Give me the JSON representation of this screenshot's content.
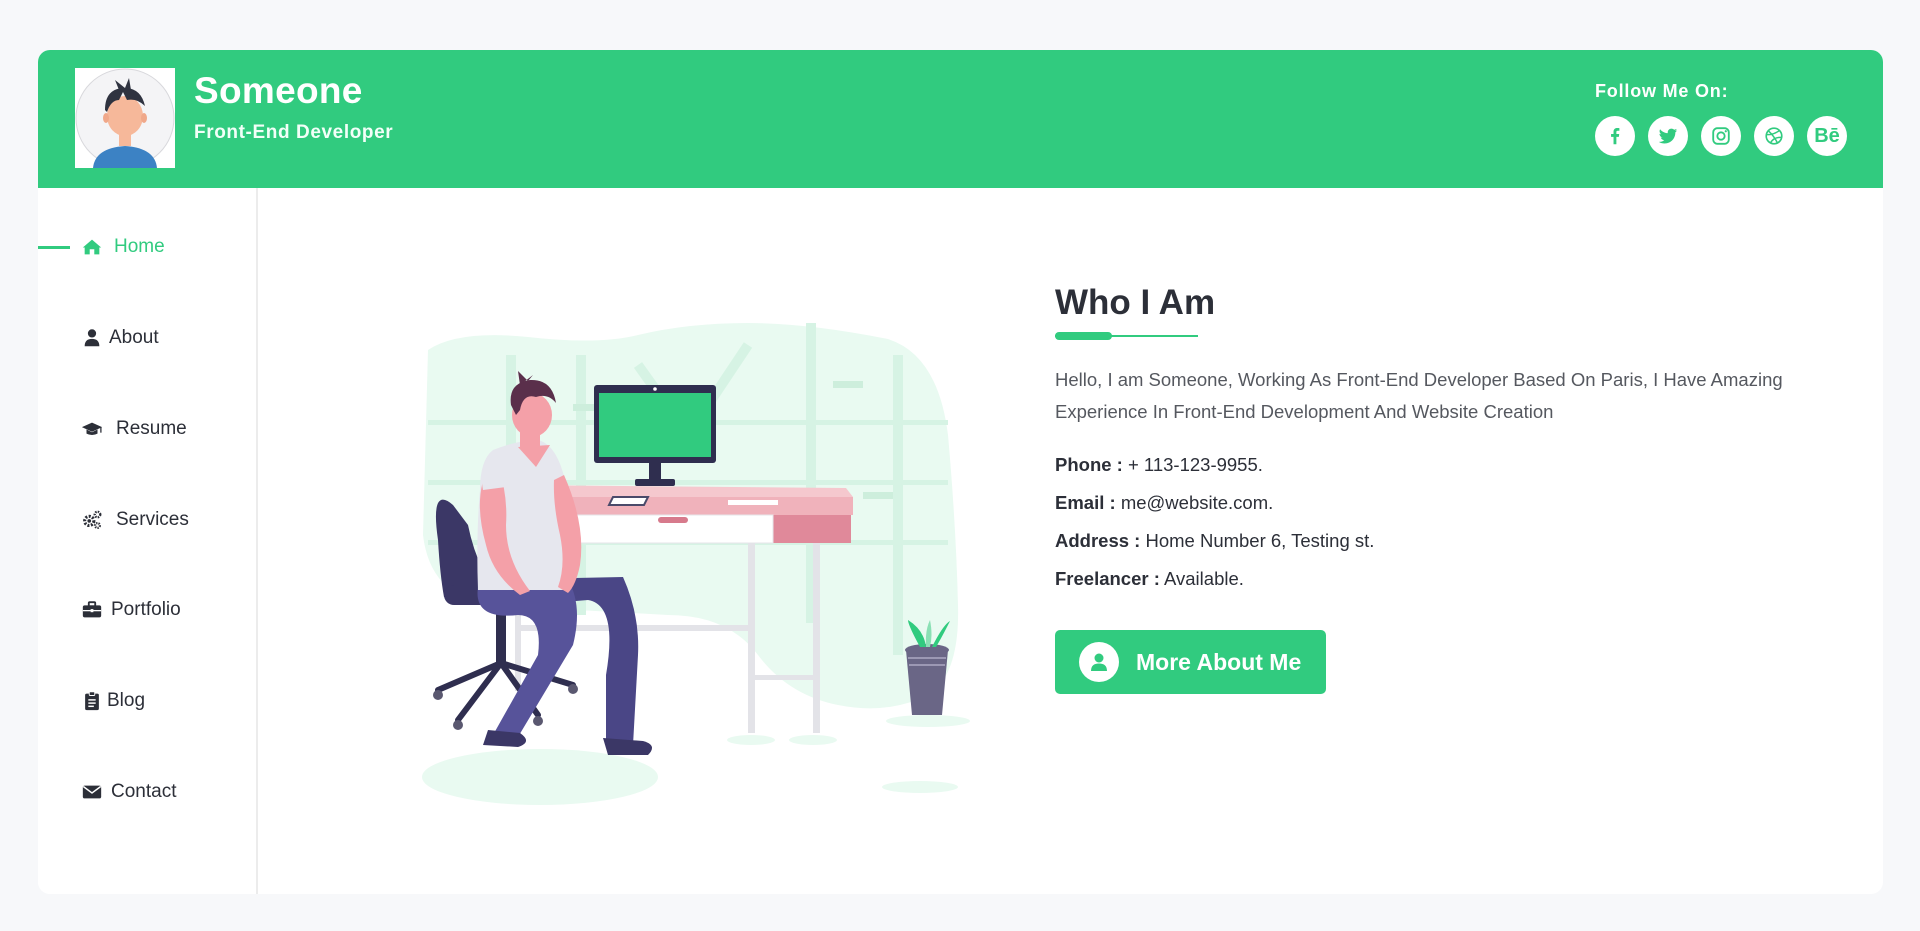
{
  "profile": {
    "name": "Someone",
    "role": "Front-End Developer"
  },
  "social": {
    "label": "Follow Me On:",
    "links": [
      {
        "icon": "facebook-icon"
      },
      {
        "icon": "twitter-icon"
      },
      {
        "icon": "instagram-icon"
      },
      {
        "icon": "dribbble-icon"
      },
      {
        "icon": "behance-icon",
        "text": "Bē"
      }
    ]
  },
  "sidebar": {
    "items": [
      {
        "label": "Home",
        "icon": "home-icon",
        "active": true
      },
      {
        "label": "About",
        "icon": "user-icon",
        "active": false
      },
      {
        "label": "Resume",
        "icon": "graduation-cap-icon",
        "active": false
      },
      {
        "label": "Services",
        "icon": "cogs-icon",
        "active": false
      },
      {
        "label": "Portfolio",
        "icon": "briefcase-icon",
        "active": false
      },
      {
        "label": "Blog",
        "icon": "clipboard-icon",
        "active": false
      },
      {
        "label": "Contact",
        "icon": "envelope-icon",
        "active": false
      }
    ]
  },
  "about": {
    "title": "Who I Am",
    "intro": "Hello, I am Someone, Working As Front-End Developer Based On Paris, I Have Amazing Experience In Front-End Development And Website Creation",
    "info": [
      {
        "key": "Phone :",
        "value": "+ 113-123-9955."
      },
      {
        "key": "Email :",
        "value": "me@website.com."
      },
      {
        "key": "Address :",
        "value": "Home Number 6, Testing st."
      },
      {
        "key": "Freelancer :",
        "value": "Available."
      }
    ],
    "cta_label": "More About Me"
  },
  "colors": {
    "accent": "#31cb7f",
    "text": "#2c2f38",
    "background": "#f7f8fa"
  }
}
